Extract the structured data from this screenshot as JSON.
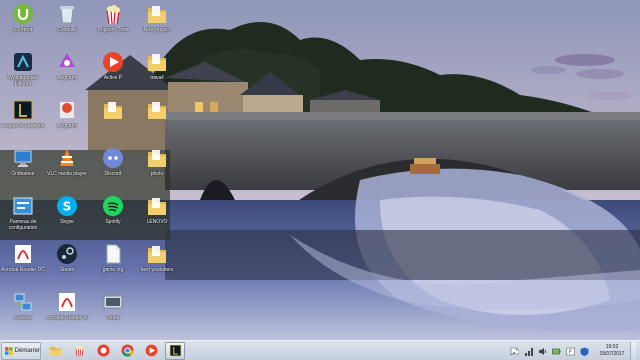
{
  "desktop": {
    "icons": [
      {
        "label": "µTorrent",
        "icon": "utorrent-icon"
      },
      {
        "label": "Corbeille",
        "icon": "recycle-bin-icon"
      },
      {
        "label": "Popcorn Time",
        "icon": "popcorn-time-icon"
      },
      {
        "label": "New project",
        "icon": "folder-icon"
      },
      {
        "label": "Wondershare Filmora",
        "icon": "filmora-icon"
      },
      {
        "label": "Anghami",
        "icon": "anghami-icon"
      },
      {
        "label": "Active P",
        "icon": "activepresenter-icon"
      },
      {
        "label": "travail",
        "icon": "folder-icon"
      },
      {
        "label": "League of Legends",
        "icon": "league-of-legends-icon"
      },
      {
        "label": "Anghami",
        "icon": "anghami-red-icon"
      },
      {
        "label": "",
        "icon": "folder-icon"
      },
      {
        "label": "",
        "icon": "folder-icon"
      },
      {
        "label": "Ordinateur",
        "icon": "computer-icon"
      },
      {
        "label": "VLC media player",
        "icon": "vlc-icon"
      },
      {
        "label": "Discord",
        "icon": "discord-icon"
      },
      {
        "label": "photo",
        "icon": "folder-icon"
      },
      {
        "label": "Panneau de configuration",
        "icon": "control-panel-icon"
      },
      {
        "label": "Skype",
        "icon": "skype-icon"
      },
      {
        "label": "Spotify",
        "icon": "spotify-icon"
      },
      {
        "label": "LENOVO",
        "icon": "folder-icon"
      },
      {
        "label": "Acrobat Reader DC",
        "icon": "acrobat-icon"
      },
      {
        "label": "Steam",
        "icon": "steam-icon"
      },
      {
        "label": "game.cfg",
        "icon": "file-icon"
      },
      {
        "label": "best youtubers",
        "icon": "folder-icon"
      },
      {
        "label": "Réseau",
        "icon": "network-icon"
      },
      {
        "label": "Acrobat Reader XI",
        "icon": "acrobat-icon"
      },
      {
        "label": "Vidéo",
        "icon": "video-shortcut-icon"
      }
    ]
  },
  "taskbar": {
    "start_label": "Démarrer",
    "pinned": [
      {
        "name": "windows-explorer-icon",
        "active": false
      },
      {
        "name": "popcorn-time-icon",
        "active": false
      },
      {
        "name": "ccleaner-icon",
        "active": false
      },
      {
        "name": "chrome-icon",
        "active": false
      },
      {
        "name": "activepresenter-icon",
        "active": false
      },
      {
        "name": "league-of-legends-icon",
        "active": true
      }
    ],
    "tray": [
      "flag-icon",
      "network-tray-icon",
      "speaker-icon",
      "battery-icon",
      "language-icon",
      "antivirus-icon"
    ],
    "clock_time": "19:02",
    "clock_date": "15/07/2017"
  },
  "colors": {
    "taskbar_bg": "#cfd8e2",
    "sky_top": "#9fa7c4",
    "sky_bottom": "#e6dbe2",
    "water": "#5d6aa1"
  }
}
